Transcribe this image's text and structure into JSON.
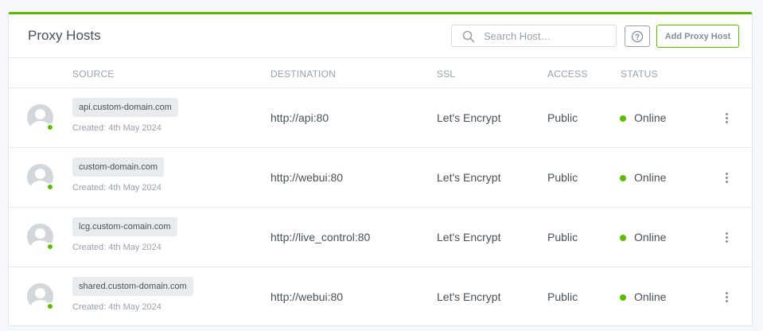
{
  "card": {
    "title": "Proxy Hosts",
    "accent_color": "#5eba00",
    "search": {
      "placeholder": "Search Host…",
      "value": "",
      "icon": "search-icon"
    },
    "help_icon": "help-icon",
    "add_button_label": "Add Proxy Host"
  },
  "table": {
    "headers": {
      "source": "SOURCE",
      "destination": "DESTINATION",
      "ssl": "SSL",
      "access": "ACCESS",
      "status": "STATUS"
    },
    "rows": [
      {
        "domain": "api.custom-domain.com",
        "created": "Created: 4th May 2024",
        "destination": "http://api:80",
        "ssl": "Let's Encrypt",
        "access": "Public",
        "status": "Online"
      },
      {
        "domain": "custom-domain.com",
        "created": "Created: 4th May 2024",
        "destination": "http://webui:80",
        "ssl": "Let's Encrypt",
        "access": "Public",
        "status": "Online"
      },
      {
        "domain": "lcg.custom-comain.com",
        "created": "Created: 4th May 2024",
        "destination": "http://live_control:80",
        "ssl": "Let's Encrypt",
        "access": "Public",
        "status": "Online"
      },
      {
        "domain": "shared.custom-domain.com",
        "created": "Created: 4th May 2024",
        "destination": "http://webui:80",
        "ssl": "Let's Encrypt",
        "access": "Public",
        "status": "Online"
      }
    ]
  }
}
